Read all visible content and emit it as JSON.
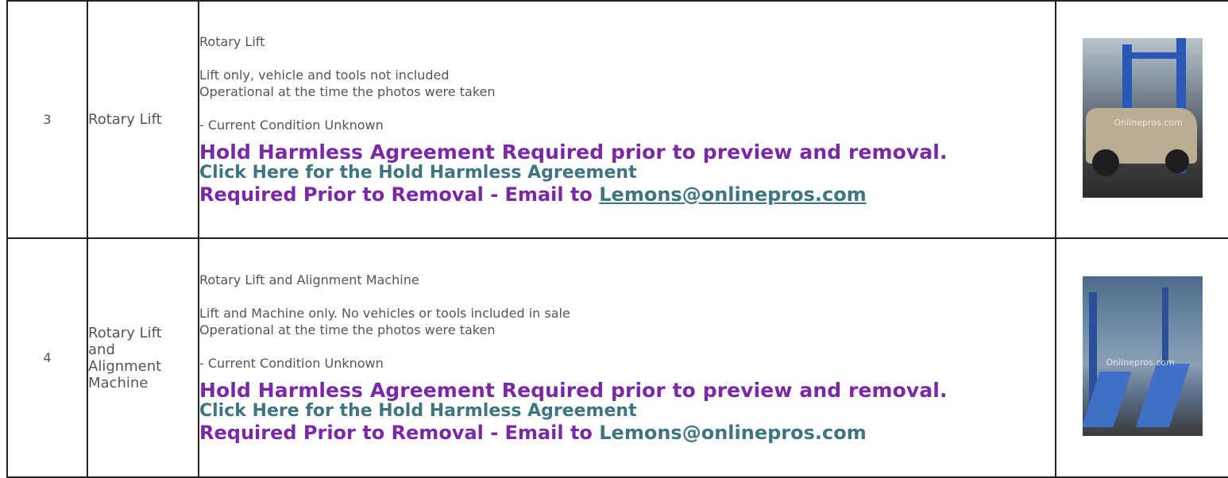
{
  "lots": [
    {
      "number": "3",
      "title_lines": [
        "Rotary Lift"
      ],
      "desc_title": "Rotary Lift",
      "desc_line1": "Lift only, vehicle and tools not included",
      "desc_line2": "Operational at the time the photos were taken",
      "condition": "- Current Condition Unknown",
      "hold_notice": "Hold Harmless Agreement Required prior to preview and removal.",
      "hold_link": "Click Here for the Hold Harmless Agreement",
      "removal_prefix": "Required Prior to Removal - Email to ",
      "email": "Lemons@onlinepros.com",
      "photo_watermark": "Onlinepros.com"
    },
    {
      "number": "4",
      "title_lines": [
        "Rotary Lift",
        "and",
        "Alignment",
        "Machine"
      ],
      "desc_title": "Rotary Lift and Alignment Machine",
      "desc_line1": "Lift and Machine only. No vehicles or tools included in sale",
      "desc_line2": "Operational at the time the photos were taken",
      "condition": "- Current Condition Unknown",
      "hold_notice": "Hold Harmless Agreement Required prior to preview and removal.",
      "hold_link": "Click Here for the Hold Harmless Agreement",
      "removal_prefix": "Required Prior to Removal - Email to ",
      "email": "Lemons@onlinepros.com",
      "photo_watermark": "Onlinepros.com"
    }
  ],
  "colors": {
    "notice_purple": "#7a28a6",
    "link_teal": "#3e7580",
    "text_gray": "#555555",
    "border": "#222222"
  }
}
